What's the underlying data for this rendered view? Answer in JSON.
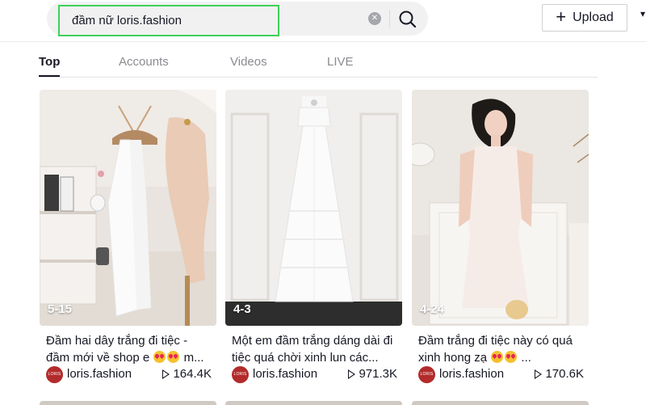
{
  "search": {
    "query": "đầm nữ loris.fashion",
    "clear_icon": "clear-icon",
    "search_icon": "search-icon"
  },
  "header": {
    "upload_label": "Upload",
    "upload_icon": "plus-icon"
  },
  "tabs": [
    {
      "label": "Top",
      "active": true
    },
    {
      "label": "Accounts",
      "active": false
    },
    {
      "label": "Videos",
      "active": false
    },
    {
      "label": "LIVE",
      "active": false
    }
  ],
  "cards": [
    {
      "date": "5-15",
      "caption_line1": "Đầm hai dây trắng đi tiệc -",
      "caption_line2": "đầm mới về shop e",
      "caption_tail": "m...",
      "author": "loris.fashion",
      "avatar_text": "LORIS",
      "views": "164.4K"
    },
    {
      "date": "4-3",
      "caption_line1": "Một em đầm trắng dáng dài đi",
      "caption_line2": "tiệc quá chời xinh lun các...",
      "caption_tail": "",
      "author": "loris.fashion",
      "avatar_text": "LORIS",
      "views": "971.3K"
    },
    {
      "date": "4-24",
      "caption_line1": "Đầm trắng đi tiệc này có quá",
      "caption_line2": "xinh hong zạ",
      "caption_tail": "...",
      "author": "loris.fashion",
      "avatar_text": "LORIS",
      "views": "170.6K"
    }
  ],
  "colors": {
    "accent_border": "#3ed15a",
    "avatar_bg": "#b32b2b",
    "text": "#161823",
    "muted": "#8a8b91"
  }
}
